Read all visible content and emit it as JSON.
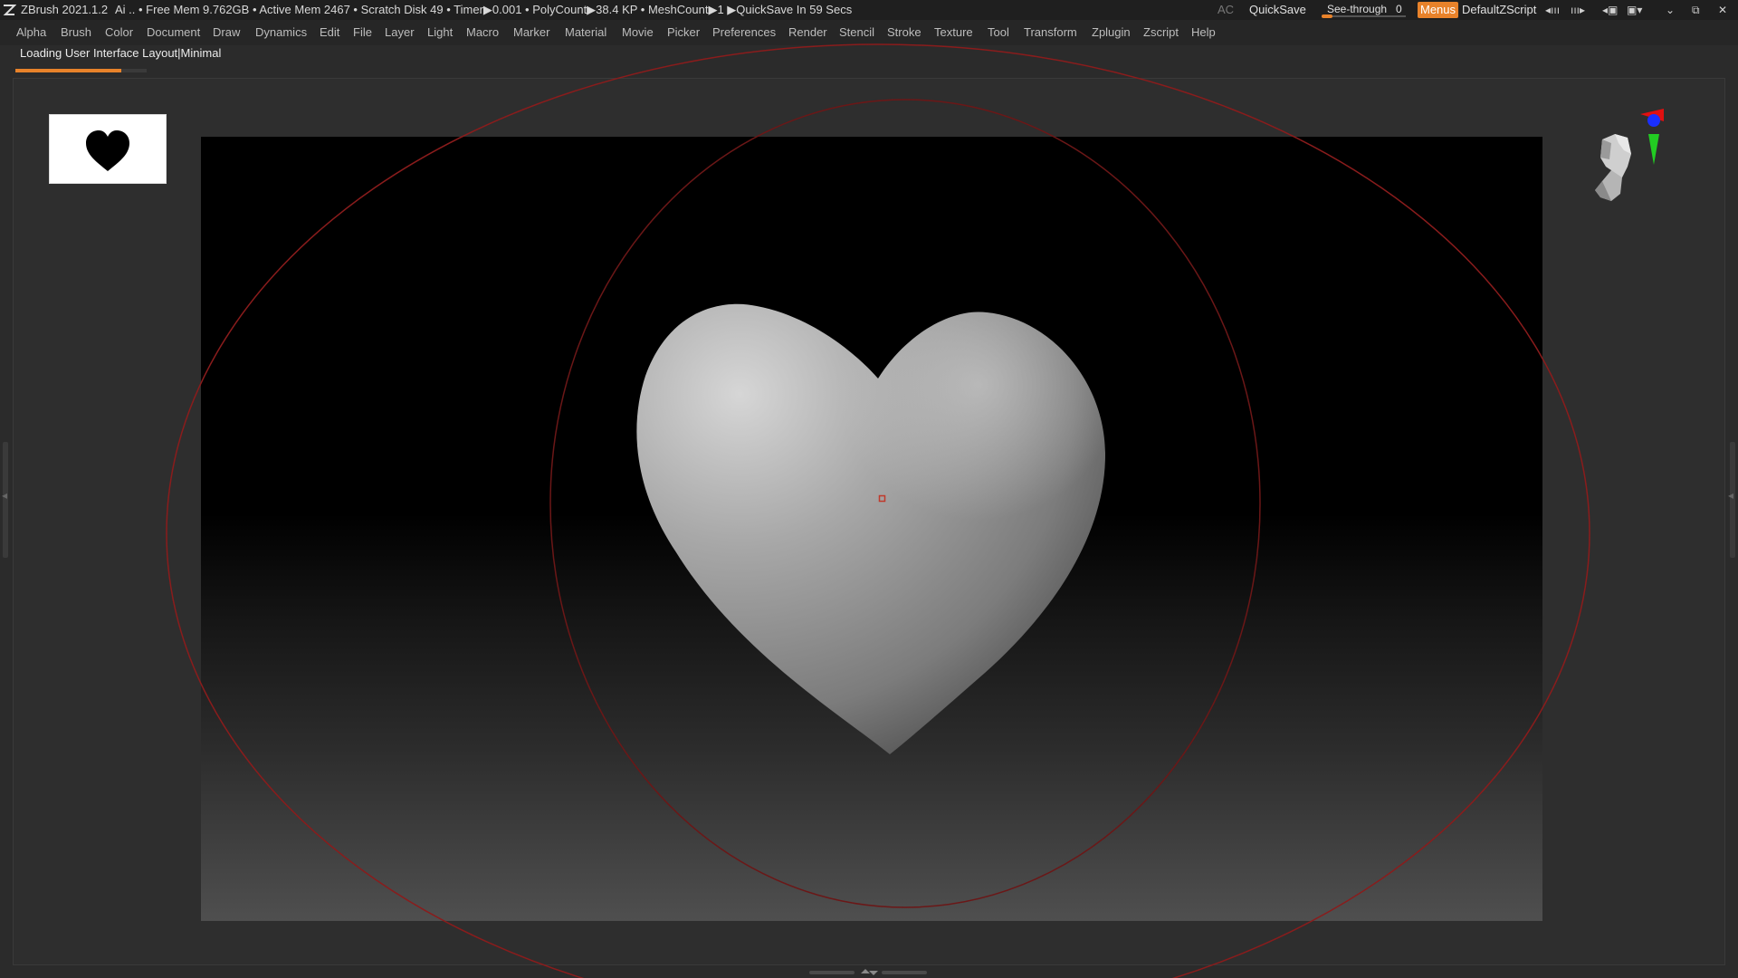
{
  "titlebar": {
    "app_title": "ZBrush 2021.1.2",
    "status": "Ai  .. • Free Mem 9.762GB • Active Mem 2467 • Scratch Disk 49 •  Timer▶0.001 • PolyCount▶38.4 KP  • MeshCount▶1  ▶QuickSave In 59 Secs",
    "ac_label": "AC",
    "quicksave_label": "QuickSave",
    "seethrough_label": "See-through",
    "seethrough_value": "0",
    "seethrough_level": 0,
    "menus_label": "Menus",
    "script_label": "DefaultZScript",
    "accent_color": "#e8822a"
  },
  "menubar": {
    "items": [
      "Alpha",
      "Brush",
      "Color",
      "Document",
      "Draw",
      "Dynamics",
      "Edit",
      "File",
      "Layer",
      "Light",
      "Macro",
      "Marker",
      "Material",
      "Movie",
      "Picker",
      "Preferences",
      "Render",
      "Stencil",
      "Stroke",
      "Texture",
      "Tool",
      "Transform",
      "Zplugin",
      "Zscript",
      "Help"
    ]
  },
  "loading": {
    "text": "Loading User Interface Layout|Minimal",
    "progress": 0.81
  },
  "viewport": {
    "model": "heart-mesh",
    "alpha_icon": "heart-icon",
    "nav_icon": "head-navigation-icon"
  }
}
